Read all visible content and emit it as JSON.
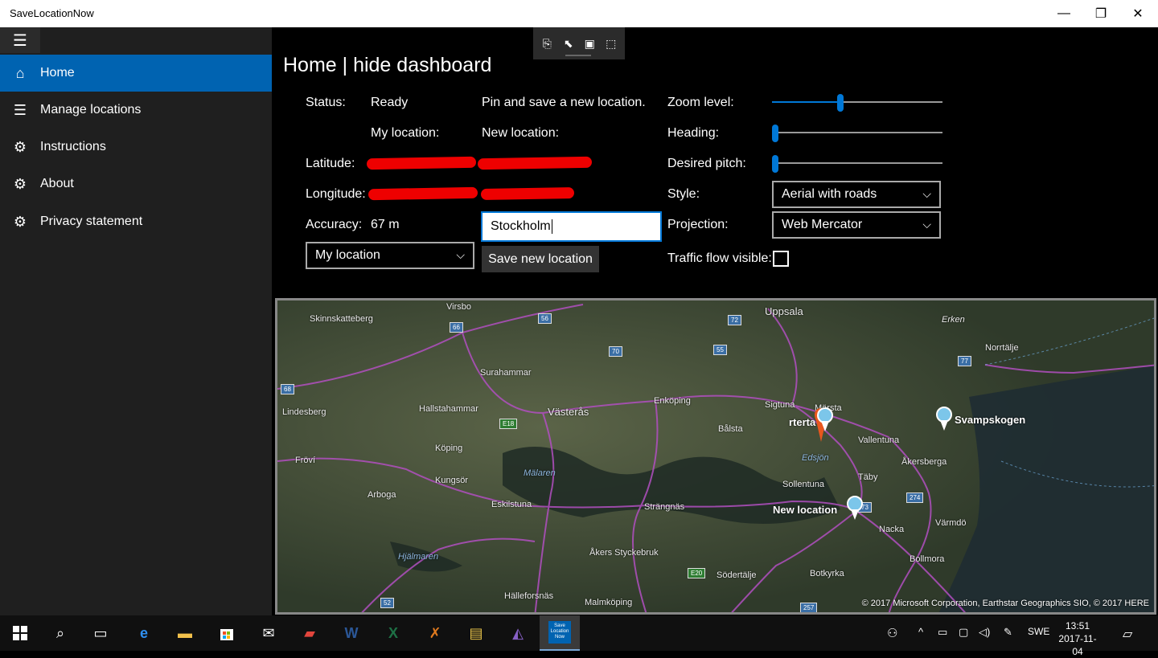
{
  "window": {
    "title": "SaveLocationNow",
    "minimize": "—",
    "maximize": "❐",
    "close": "✕"
  },
  "sidebar": {
    "items": [
      {
        "label": "Home",
        "icon": "home-icon"
      },
      {
        "label": "Manage locations",
        "icon": "list-icon"
      },
      {
        "label": "Instructions",
        "icon": "gear-icon"
      },
      {
        "label": "About",
        "icon": "gear-icon"
      },
      {
        "label": "Privacy statement",
        "icon": "gear-icon"
      }
    ]
  },
  "header": {
    "title": "Home | hide dashboard"
  },
  "dashboard": {
    "status_label": "Status:",
    "status_value": "Ready",
    "pin_hint": "Pin and save a new location.",
    "my_location_label": "My location:",
    "new_location_label": "New location:",
    "latitude_label": "Latitude:",
    "longitude_label": "Longitude:",
    "accuracy_label": "Accuracy:",
    "accuracy_value": "67 m",
    "location_select": "My location",
    "new_location_input": "Stockholm",
    "save_button": "Save new location",
    "zoom_label": "Zoom level:",
    "zoom_level": 0.4,
    "heading_label": "Heading:",
    "heading_level": 0.0,
    "pitch_label": "Desired pitch:",
    "pitch_level": 0.0,
    "style_label": "Style:",
    "style_value": "Aerial with roads",
    "projection_label": "Projection:",
    "projection_value": "Web Mercator",
    "traffic_label": "Traffic flow visible:",
    "traffic_checked": false
  },
  "map": {
    "cities": [
      "Uppsala",
      "Virsbo",
      "Skinnskatteberg",
      "Surahammar",
      "Västerås",
      "Enköping",
      "Sigtuna",
      "Märsta",
      "Bålsta",
      "Norrtälje",
      "Erken",
      "Lindesberg",
      "Hallstahammar",
      "Köping",
      "Fröví",
      "Arboga",
      "Kungsör",
      "Mälaren",
      "Eskilstuna",
      "Strängnäs",
      "Vallentuna",
      "Åkersberga",
      "Täby",
      "Sollentuna",
      "Edsjön",
      "Nacka",
      "Värmdö",
      "Bollmora",
      "Hjälmaren",
      "Åkers Styckebruk",
      "Södertälje",
      "Botkyrka",
      "Malmköping",
      "Hälleforsnäs",
      "rterta"
    ],
    "roads": [
      "66",
      "56",
      "72",
      "55",
      "70",
      "68",
      "E18",
      "77",
      "E20",
      "274",
      "52",
      "257",
      "73"
    ],
    "pins": [
      "Svampskogen",
      "New location"
    ],
    "copyright": "© 2017 Microsoft Corporation, Earthstar Geographics  SIO, © 2017 HERE"
  },
  "taskbar": {
    "time": "13:51",
    "date": "2017-11-04",
    "lang": "SWE",
    "active_app": "Save Location Now"
  }
}
